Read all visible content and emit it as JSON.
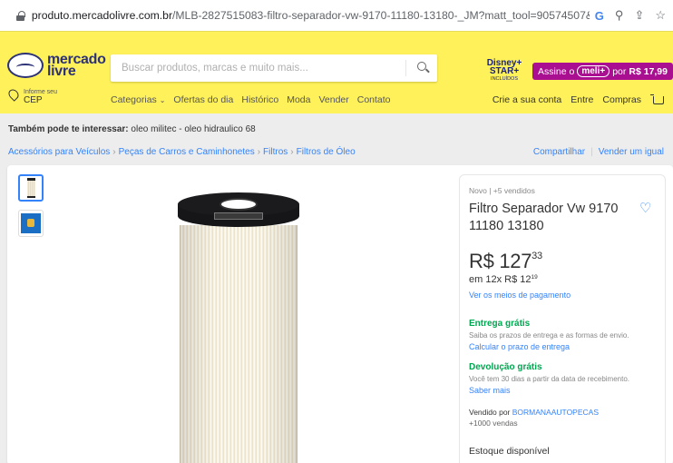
{
  "browser": {
    "url_host": "produto.mercadolivre.com.br",
    "url_path": "/MLB-2827515083-filtro-separador-vw-9170-11180-13180-_JM?matt_tool=90574507&matt_word=&matt_source=go...",
    "icons": [
      "lock-icon",
      "google-icon",
      "zoom-icon",
      "share-icon",
      "star-icon"
    ]
  },
  "header": {
    "logo_line1": "mercado",
    "logo_line2": "livre",
    "search_placeholder": "Buscar produtos, marcas e muito mais...",
    "disney_label": "Disney+ STAR+",
    "disney_sub": "INCLUÍDOS",
    "meli_prefix": "Assine o",
    "meli_pill": "meli+",
    "meli_suffix": "por",
    "meli_price": "R$ 17,99",
    "cep_small": "Informe seu",
    "cep_big": "CEP",
    "nav": {
      "categorias": "Categorias",
      "ofertas": "Ofertas do dia",
      "historico": "Histórico",
      "moda": "Moda",
      "vender": "Vender",
      "contato": "Contato"
    },
    "account": {
      "crie": "Crie a sua conta",
      "entre": "Entre",
      "compras": "Compras"
    },
    "colors": {
      "yellow": "#fff159",
      "brand_blue": "#2d3277",
      "meli_purple": "#a90f90"
    }
  },
  "also": {
    "label": "Também pode te interessar:",
    "items": "oleo militec - oleo hidraulico 68"
  },
  "breadcrumb": {
    "c1": "Acessórios para Veículos",
    "c2": "Peças de Carros e Caminhonetes",
    "c3": "Filtros",
    "c4": "Filtros de Óleo",
    "share": "Compartilhar",
    "sell": "Vender um igual"
  },
  "product": {
    "condition": "Novo  |  +5 vendidos",
    "title": "Filtro Separador Vw 9170 11180 13180",
    "price_main": "R$ 127",
    "price_cents": "33",
    "installments": "em 12x R$ 12",
    "installment_cents": "19",
    "payment_link": "Ver os meios de pagamento",
    "shipping_title": "Entrega grátis",
    "shipping_text": "Saiba os prazos de entrega e as formas de envio.",
    "shipping_link": "Calcular o prazo de entrega",
    "return_title": "Devolução grátis",
    "return_text": "Você tem 30 dias a partir da data de recebimento.",
    "return_link": "Saber mais",
    "seller_prefix": "Vendido por",
    "seller_name": "BORMANAAUTOPECAS",
    "seller_sales": "+1000 vendas",
    "stock": "Estoque disponível"
  }
}
